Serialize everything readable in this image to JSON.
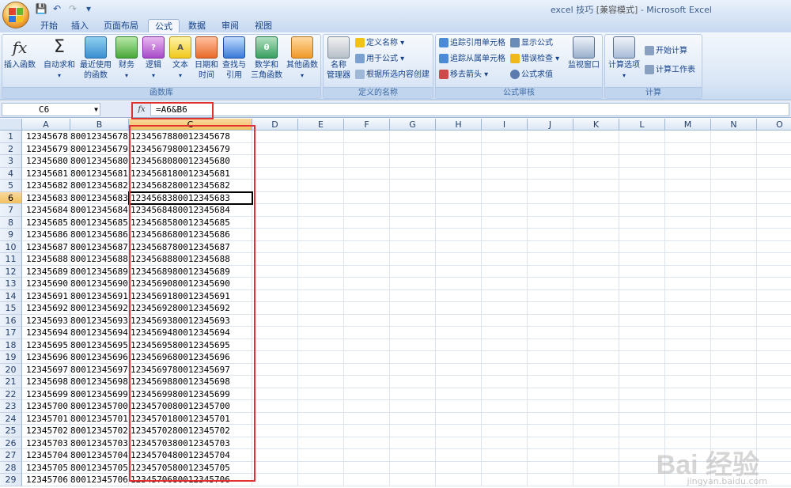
{
  "window": {
    "title": "excel 技巧",
    "mode": "[兼容模式]",
    "app": "- Microsoft Excel"
  },
  "qat": {
    "icons": [
      "save-icon",
      "undo-icon",
      "redo-icon",
      "customize-icon"
    ]
  },
  "tabs": [
    "开始",
    "插入",
    "页面布局",
    "公式",
    "数据",
    "审阅",
    "视图"
  ],
  "active_tab": "公式",
  "ribbon": {
    "function_library": {
      "label": "函数库",
      "insert_function": "插入函数",
      "autosum": "自动求和",
      "recent_1": "最近使用",
      "recent_2": "的函数",
      "financial": "财务",
      "logical": "逻辑",
      "text": "文本",
      "datetime_1": "日期和",
      "datetime_2": "时间",
      "lookup_1": "查找与",
      "lookup_2": "引用",
      "math_1": "数学和",
      "math_2": "三角函数",
      "other": "其他函数"
    },
    "defined_names": {
      "label": "定义的名称",
      "name_manager_1": "名称",
      "name_manager_2": "管理器",
      "define_name": "定义名称",
      "use_in_formula": "用于公式",
      "create_from_selection": "根据所选内容创建"
    },
    "formula_auditing": {
      "label": "公式审核",
      "trace_precedents": "追踪引用单元格",
      "trace_dependents": "追踪从属单元格",
      "remove_arrows": "移去箭头",
      "show_formulas": "显示公式",
      "error_checking": "错误检查",
      "evaluate_formula": "公式求值",
      "watch_window": "监视窗口"
    },
    "calculation": {
      "label": "计算",
      "calc_options": "计算选项",
      "calc_now": "开始计算",
      "calc_sheet": "计算工作表"
    }
  },
  "formula_bar": {
    "name_box": "C6",
    "fx": "fx",
    "formula": "=A6&B6"
  },
  "columns": [
    "A",
    "B",
    "C",
    "D",
    "E",
    "F",
    "G",
    "H",
    "I",
    "J",
    "K",
    "L",
    "M",
    "N",
    "O"
  ],
  "rows": [
    {
      "n": "1",
      "a": "12345678",
      "b": "80012345678",
      "c": "1234567880012345678"
    },
    {
      "n": "2",
      "a": "12345679",
      "b": "80012345679",
      "c": "1234567980012345679"
    },
    {
      "n": "3",
      "a": "12345680",
      "b": "80012345680",
      "c": "1234568080012345680"
    },
    {
      "n": "4",
      "a": "12345681",
      "b": "80012345681",
      "c": "1234568180012345681"
    },
    {
      "n": "5",
      "a": "12345682",
      "b": "80012345682",
      "c": "1234568280012345682"
    },
    {
      "n": "6",
      "a": "12345683",
      "b": "80012345683",
      "c": "1234568380012345683"
    },
    {
      "n": "7",
      "a": "12345684",
      "b": "80012345684",
      "c": "1234568480012345684"
    },
    {
      "n": "8",
      "a": "12345685",
      "b": "80012345685",
      "c": "1234568580012345685"
    },
    {
      "n": "9",
      "a": "12345686",
      "b": "80012345686",
      "c": "1234568680012345686"
    },
    {
      "n": "10",
      "a": "12345687",
      "b": "80012345687",
      "c": "1234568780012345687"
    },
    {
      "n": "11",
      "a": "12345688",
      "b": "80012345688",
      "c": "1234568880012345688"
    },
    {
      "n": "12",
      "a": "12345689",
      "b": "80012345689",
      "c": "1234568980012345689"
    },
    {
      "n": "13",
      "a": "12345690",
      "b": "80012345690",
      "c": "1234569080012345690"
    },
    {
      "n": "14",
      "a": "12345691",
      "b": "80012345691",
      "c": "1234569180012345691"
    },
    {
      "n": "15",
      "a": "12345692",
      "b": "80012345692",
      "c": "1234569280012345692"
    },
    {
      "n": "16",
      "a": "12345693",
      "b": "80012345693",
      "c": "1234569380012345693"
    },
    {
      "n": "17",
      "a": "12345694",
      "b": "80012345694",
      "c": "1234569480012345694"
    },
    {
      "n": "18",
      "a": "12345695",
      "b": "80012345695",
      "c": "1234569580012345695"
    },
    {
      "n": "19",
      "a": "12345696",
      "b": "80012345696",
      "c": "1234569680012345696"
    },
    {
      "n": "20",
      "a": "12345697",
      "b": "80012345697",
      "c": "1234569780012345697"
    },
    {
      "n": "21",
      "a": "12345698",
      "b": "80012345698",
      "c": "1234569880012345698"
    },
    {
      "n": "22",
      "a": "12345699",
      "b": "80012345699",
      "c": "1234569980012345699"
    },
    {
      "n": "23",
      "a": "12345700",
      "b": "80012345700",
      "c": "1234570080012345700"
    },
    {
      "n": "24",
      "a": "12345701",
      "b": "80012345701",
      "c": "1234570180012345701"
    },
    {
      "n": "25",
      "a": "12345702",
      "b": "80012345702",
      "c": "1234570280012345702"
    },
    {
      "n": "26",
      "a": "12345703",
      "b": "80012345703",
      "c": "1234570380012345703"
    },
    {
      "n": "27",
      "a": "12345704",
      "b": "80012345704",
      "c": "1234570480012345704"
    },
    {
      "n": "28",
      "a": "12345705",
      "b": "80012345705",
      "c": "1234570580012345705"
    },
    {
      "n": "29",
      "a": "12345706",
      "b": "80012345706",
      "c": "1234570680012345706"
    }
  ],
  "watermark": {
    "main": "Bai 经验",
    "sub": "jingyan.baidu.com"
  }
}
